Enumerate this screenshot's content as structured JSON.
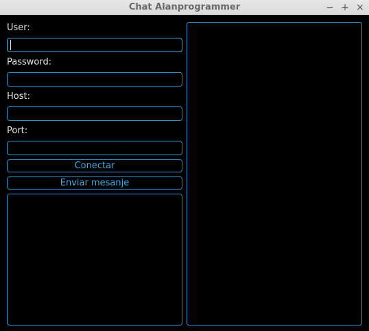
{
  "window": {
    "title": "Chat Alanprogrammer",
    "controls": {
      "minimize": "−",
      "maximize": "+",
      "close": "×"
    }
  },
  "form": {
    "user_label": "User:",
    "user_value": "",
    "password_label": "Password:",
    "password_value": "",
    "host_label": "Host:",
    "host_value": "",
    "port_label": "Port:",
    "port_value": ""
  },
  "buttons": {
    "connect_label": "Conectar",
    "send_label": "Enviar mesanje"
  },
  "colors": {
    "accent": "#3daee9",
    "border": "#2e95d3",
    "background": "#000000",
    "text": "#e6e6e6"
  }
}
